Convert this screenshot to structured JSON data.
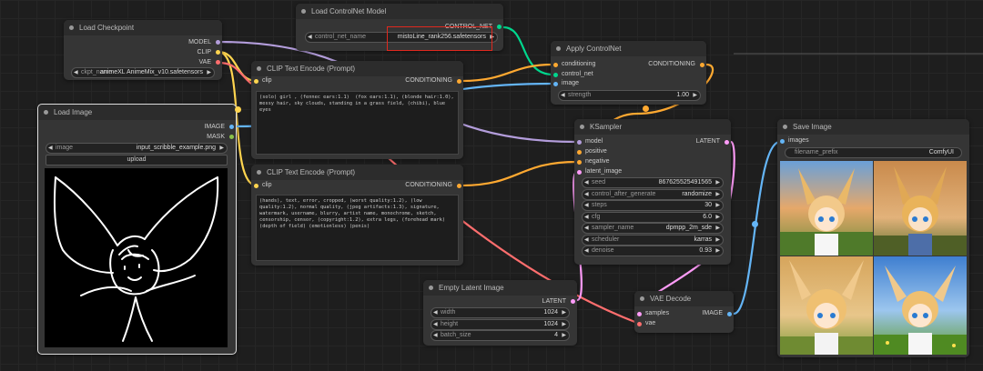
{
  "colors": {
    "model": "#b39ddb",
    "clip": "#ffd54f",
    "vae": "#ff6e6e",
    "conditioning": "#ffa931",
    "latent": "#ff9cf9",
    "image": "#64b5f6",
    "controlnet": "#00d78d"
  },
  "nodes": {
    "load_checkpoint": {
      "title": "Load Checkpoint",
      "out_model": "MODEL",
      "out_clip": "CLIP",
      "out_vae": "VAE",
      "ckpt_label": "ckpt_name",
      "ckpt_value": "animeXL AnimeMix_v10.safetensors"
    },
    "load_controlnet": {
      "title": "Load ControlNet Model",
      "out": "CONTROL_NET",
      "label": "control_net_name",
      "value": "mistoLine_rank256.safetensors"
    },
    "apply_controlnet": {
      "title": "Apply ControlNet",
      "in_conditioning": "conditioning",
      "in_control_net": "control_net",
      "in_image": "image",
      "out": "CONDITIONING",
      "strength_label": "strength",
      "strength_value": "1.00"
    },
    "clip_pos": {
      "title": "CLIP Text Encode (Prompt)",
      "in": "clip",
      "out": "CONDITIONING",
      "text": "(solo) girl , (fennec ears:1.1)  (fox ears:1.1), (blonde hair:1.0), messy hair, sky clouds, standing in a grass field, (chibi), blue eyes"
    },
    "clip_neg": {
      "title": "CLIP Text Encode (Prompt)",
      "in": "clip",
      "out": "CONDITIONING",
      "text": "(hands), text, error, cropped, (worst quality:1.2), (low quality:1.2), normal quality, (jpeg artifacts:1.3), signature, watermark, username, blurry, artist name, monochrome, sketch, censorship, censor, (copyright:1.2), extra legs, (forehead mark) (depth of field) (emotionless) (penis)"
    },
    "load_image": {
      "title": "Load Image",
      "out_image": "IMAGE",
      "out_mask": "MASK",
      "image_label": "image",
      "image_value": "input_scribble_example.png",
      "upload": "upload"
    },
    "ksampler": {
      "title": "KSampler",
      "in_model": "model",
      "in_positive": "positive",
      "in_negative": "negative",
      "in_latent": "latent_image",
      "out": "LATENT",
      "widgets": [
        {
          "label": "seed",
          "value": "867625525491565"
        },
        {
          "label": "control_after_generate",
          "value": "randomize"
        },
        {
          "label": "steps",
          "value": "30"
        },
        {
          "label": "cfg",
          "value": "6.0"
        },
        {
          "label": "sampler_name",
          "value": "dpmpp_2m_sde"
        },
        {
          "label": "scheduler",
          "value": "karras"
        },
        {
          "label": "denoise",
          "value": "0.93"
        }
      ]
    },
    "empty_latent": {
      "title": "Empty Latent Image",
      "out": "LATENT",
      "widgets": [
        {
          "label": "width",
          "value": "1024"
        },
        {
          "label": "height",
          "value": "1024"
        },
        {
          "label": "batch_size",
          "value": "4"
        }
      ]
    },
    "vae_decode": {
      "title": "VAE Decode",
      "in_samples": "samples",
      "in_vae": "vae",
      "out": "IMAGE"
    },
    "save_image": {
      "title": "Save Image",
      "in_images": "images",
      "prefix_label": "filename_prefix",
      "prefix_value": "ComfyUI"
    }
  }
}
